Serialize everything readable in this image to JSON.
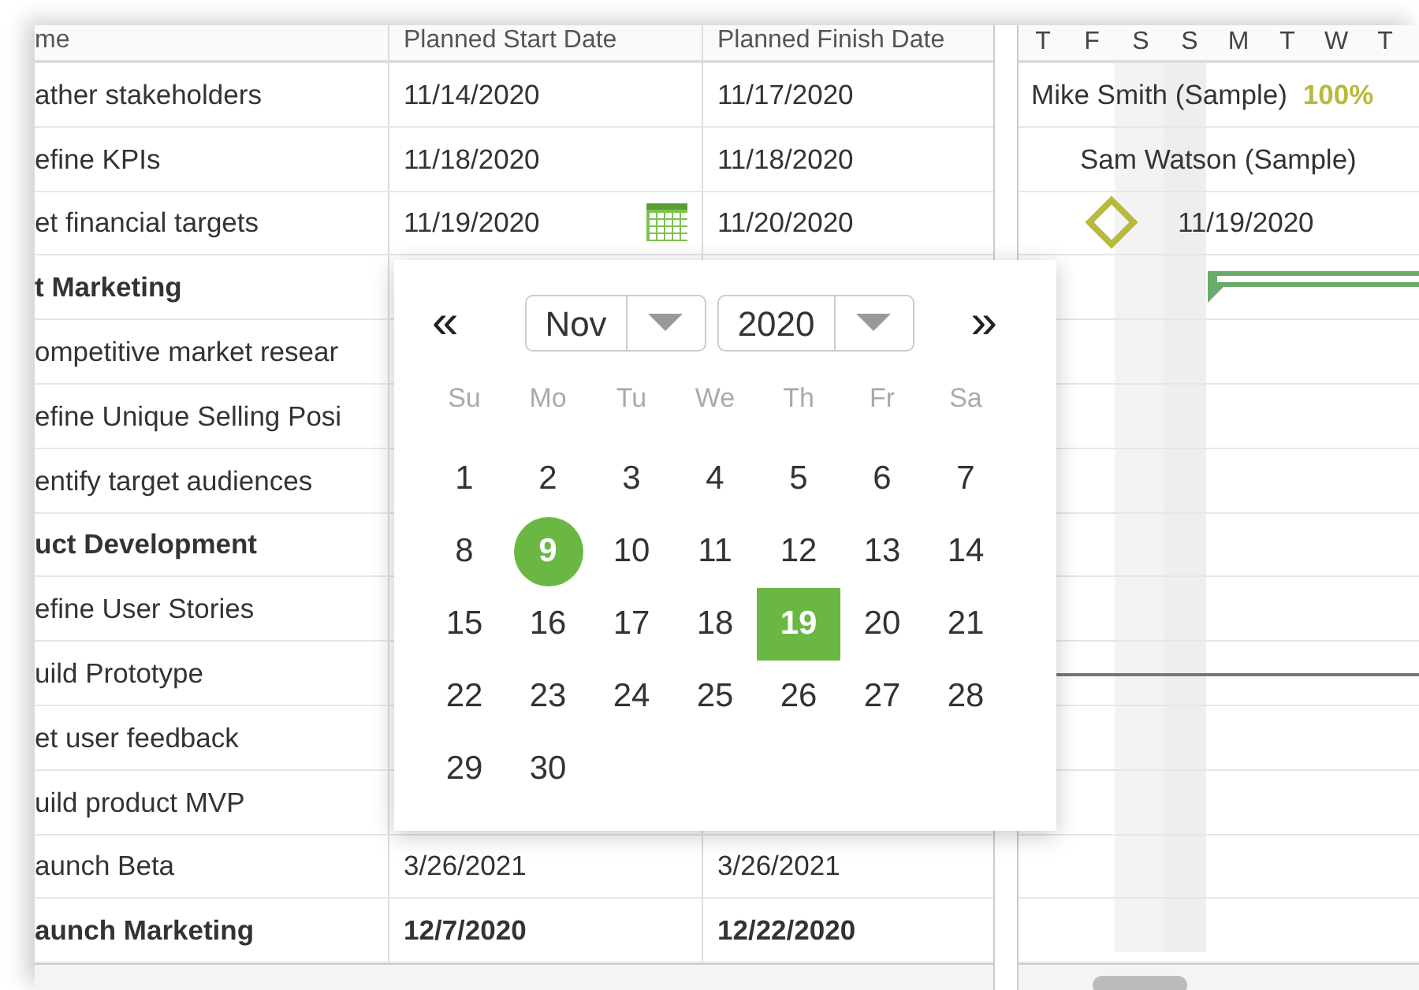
{
  "table": {
    "columns": [
      "me",
      "Planned Start Date",
      "Planned Finish Date"
    ],
    "rows": [
      {
        "name": "ather stakeholders",
        "bold": false,
        "start": "11/14/2020",
        "finish": "11/17/2020",
        "editing": false
      },
      {
        "name": "efine KPIs",
        "bold": false,
        "start": "11/18/2020",
        "finish": "11/18/2020",
        "editing": false
      },
      {
        "name": "et financial targets",
        "bold": false,
        "start": "11/19/2020",
        "finish": "11/20/2020",
        "editing": true
      },
      {
        "name": "t Marketing",
        "bold": true
      },
      {
        "name": "ompetitive market resear",
        "bold": false
      },
      {
        "name": "efine Unique Selling Posi",
        "bold": false
      },
      {
        "name": "entify target audiences",
        "bold": false
      },
      {
        "name": "uct Development",
        "bold": true
      },
      {
        "name": "efine User Stories",
        "bold": false
      },
      {
        "name": "uild Prototype",
        "bold": false
      },
      {
        "name": "et user feedback",
        "bold": false
      },
      {
        "name": "uild product MVP",
        "bold": false
      },
      {
        "name": "aunch Beta",
        "bold": false,
        "start": "3/26/2021",
        "finish": "3/26/2021",
        "editing": false
      },
      {
        "name": "aunch Marketing",
        "bold": true,
        "start": "12/7/2020",
        "finish": "12/22/2020",
        "editing": false
      }
    ]
  },
  "gantt": {
    "day_headers": [
      "T",
      "F",
      "S",
      "S",
      "M",
      "T",
      "W",
      "T"
    ],
    "rows": [
      {
        "kind": "progress_label",
        "text": "Mike Smith (Sample)",
        "percent": "100%"
      },
      {
        "kind": "resource_label",
        "text": "Sam Watson (Sample)"
      },
      {
        "kind": "milestone",
        "text": "11/19/2020"
      },
      {
        "kind": "summary"
      }
    ]
  },
  "date_picker": {
    "prev": "«",
    "next": "»",
    "month": "Nov",
    "year": "2020",
    "weekdays": [
      "Su",
      "Mo",
      "Tu",
      "We",
      "Th",
      "Fr",
      "Sa"
    ],
    "days": [
      {
        "label": "1",
        "selected": false,
        "today": false
      },
      {
        "label": "2",
        "selected": false,
        "today": false
      },
      {
        "label": "3",
        "selected": false,
        "today": false
      },
      {
        "label": "4",
        "selected": false,
        "today": false
      },
      {
        "label": "5",
        "selected": false,
        "today": false
      },
      {
        "label": "6",
        "selected": false,
        "today": false
      },
      {
        "label": "7",
        "selected": false,
        "today": false
      },
      {
        "label": "8",
        "selected": false,
        "today": false
      },
      {
        "label": "9",
        "selected": false,
        "today": true
      },
      {
        "label": "10",
        "selected": false,
        "today": false
      },
      {
        "label": "11",
        "selected": false,
        "today": false
      },
      {
        "label": "12",
        "selected": false,
        "today": false
      },
      {
        "label": "13",
        "selected": false,
        "today": false
      },
      {
        "label": "14",
        "selected": false,
        "today": false
      },
      {
        "label": "15",
        "selected": false,
        "today": false
      },
      {
        "label": "16",
        "selected": false,
        "today": false
      },
      {
        "label": "17",
        "selected": false,
        "today": false
      },
      {
        "label": "18",
        "selected": false,
        "today": false
      },
      {
        "label": "19",
        "selected": true,
        "today": false
      },
      {
        "label": "20",
        "selected": false,
        "today": false
      },
      {
        "label": "21",
        "selected": false,
        "today": false
      },
      {
        "label": "22",
        "selected": false,
        "today": false
      },
      {
        "label": "23",
        "selected": false,
        "today": false
      },
      {
        "label": "24",
        "selected": false,
        "today": false
      },
      {
        "label": "25",
        "selected": false,
        "today": false
      },
      {
        "label": "26",
        "selected": false,
        "today": false
      },
      {
        "label": "27",
        "selected": false,
        "today": false
      },
      {
        "label": "28",
        "selected": false,
        "today": false
      },
      {
        "label": "29",
        "selected": false,
        "today": false
      },
      {
        "label": "30",
        "selected": false,
        "today": false
      }
    ]
  }
}
